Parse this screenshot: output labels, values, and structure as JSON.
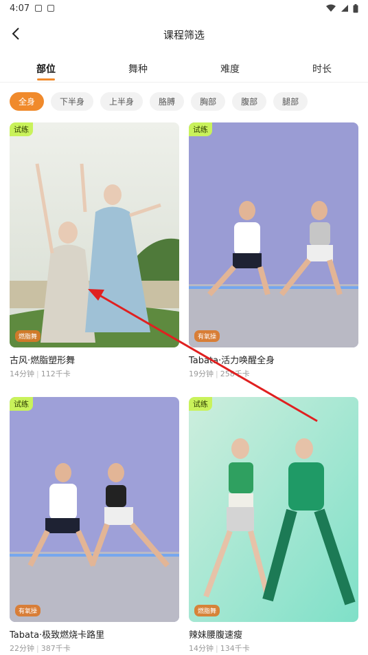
{
  "status_bar": {
    "time": "4:07"
  },
  "header": {
    "title": "课程筛选"
  },
  "tabs": [
    {
      "label": "部位",
      "active": true
    },
    {
      "label": "舞种",
      "active": false
    },
    {
      "label": "难度",
      "active": false
    },
    {
      "label": "时长",
      "active": false
    }
  ],
  "chips": [
    {
      "label": "全身",
      "active": true
    },
    {
      "label": "下半身",
      "active": false
    },
    {
      "label": "上半身",
      "active": false
    },
    {
      "label": "胳膊",
      "active": false
    },
    {
      "label": "胸部",
      "active": false
    },
    {
      "label": "腹部",
      "active": false
    },
    {
      "label": "腿部",
      "active": false
    }
  ],
  "courses": [
    {
      "title": "古风·燃脂塑形舞",
      "trial": "试练",
      "type": "燃脂舞",
      "duration": "14分钟",
      "calories": "112千卡"
    },
    {
      "title": "Tabata·活力唤醒全身",
      "trial": "试练",
      "type": "有氧操",
      "duration": "19分钟",
      "calories": "258千卡"
    },
    {
      "title": "Tabata·极致燃烧卡路里",
      "trial": "试练",
      "type": "有氧操",
      "duration": "22分钟",
      "calories": "387千卡"
    },
    {
      "title": "辣妹腰腹速瘦",
      "trial": "试练",
      "type": "燃脂舞",
      "duration": "14分钟",
      "calories": "134千卡"
    }
  ],
  "colors": {
    "accent": "#f08a2c",
    "trial_badge": "#c9f25b",
    "arrow": "#e02020"
  }
}
